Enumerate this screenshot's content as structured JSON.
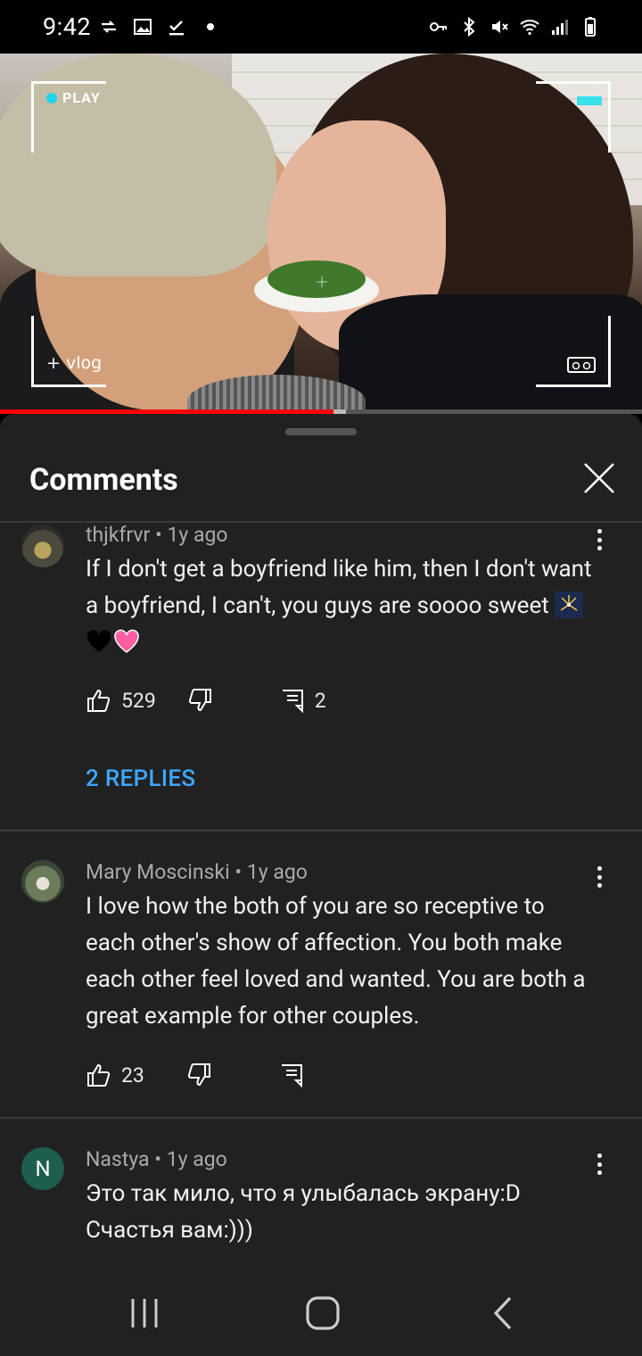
{
  "status": {
    "time": "9:42"
  },
  "video": {
    "overlay_play": "PLAY",
    "overlay_vlog": "+ vlog",
    "progress_percent": 52
  },
  "panel": {
    "title": "Comments"
  },
  "comments": [
    {
      "author_meta": "thjkfrvr • 1y ago",
      "text": "If I don't get a boyfriend like him, then I don't want a boyfriend, I can't, you guys are soooo sweet",
      "likes": "529",
      "reply_count": "2",
      "replies_link": "2 REPLIES"
    },
    {
      "author_meta": "Mary Moscinski • 1y ago",
      "text": "I love how the both of you are so receptive to each other's show of affection. You both make each other feel loved and wanted. You are both a great example for other couples.",
      "likes": "23"
    },
    {
      "author_meta": "Nastya • 1y ago",
      "avatar_letter": "N",
      "text": "Это так мило, что я улыбалась экрану:D Счастья вам:)))"
    }
  ],
  "colors": {
    "panel_bg": "#212121",
    "link_blue": "#3ea6ff",
    "progress_red": "#ff0000",
    "avatar_n_bg": "#1d5e4c"
  }
}
